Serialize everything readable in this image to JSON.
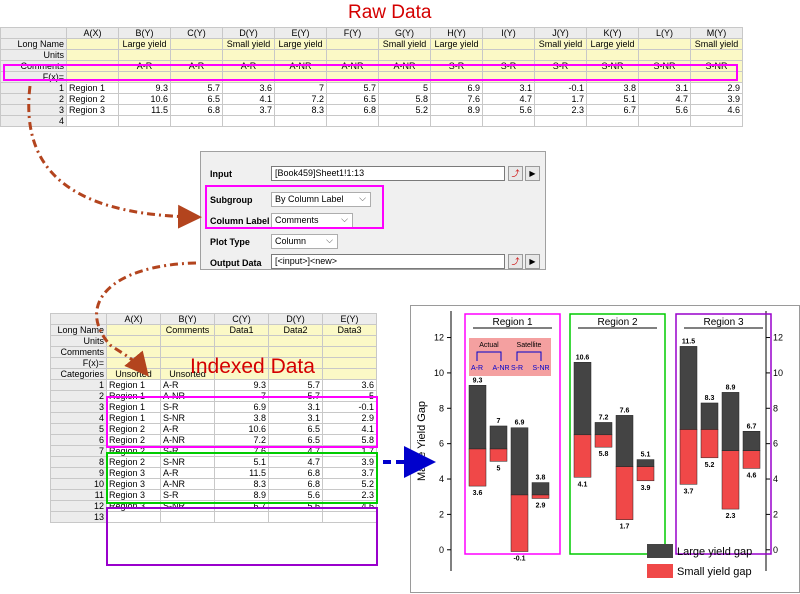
{
  "titles": {
    "raw": "Raw Data",
    "indexed": "Indexed Data"
  },
  "raw": {
    "columns": [
      "A(X)",
      "B(Y)",
      "C(Y)",
      "D(Y)",
      "E(Y)",
      "F(Y)",
      "G(Y)",
      "H(Y)",
      "I(Y)",
      "J(Y)",
      "K(Y)",
      "L(Y)",
      "M(Y)"
    ],
    "meta": [
      {
        "label": "Long Name",
        "cells": [
          "",
          "Large yield",
          "",
          "Small yield",
          "Large yield",
          "",
          "Small yield",
          "Large yield",
          "",
          "Small yield",
          "Large yield",
          "",
          "Small yield"
        ]
      },
      {
        "label": "Units",
        "cells": [
          "",
          "",
          "",
          "",
          "",
          "",
          "",
          "",
          "",
          "",
          "",
          "",
          ""
        ]
      },
      {
        "label": "Comments",
        "cells": [
          "",
          "A-R",
          "A-R",
          "A-R",
          "A-NR",
          "A-NR",
          "A-NR",
          "S-R",
          "S-R",
          "S-R",
          "S-NR",
          "S-NR",
          "S-NR"
        ]
      },
      {
        "label": "F(x)=",
        "cells": [
          "",
          "",
          "",
          "",
          "",
          "",
          "",
          "",
          "",
          "",
          "",
          "",
          ""
        ]
      }
    ],
    "rows": [
      {
        "n": "1",
        "cells": [
          "Region 1",
          "9.3",
          "5.7",
          "3.6",
          "7",
          "5.7",
          "5",
          "6.9",
          "3.1",
          "-0.1",
          "3.8",
          "3.1",
          "2.9"
        ]
      },
      {
        "n": "2",
        "cells": [
          "Region 2",
          "10.6",
          "6.5",
          "4.1",
          "7.2",
          "6.5",
          "5.8",
          "7.6",
          "4.7",
          "1.7",
          "5.1",
          "4.7",
          "3.9"
        ]
      },
      {
        "n": "3",
        "cells": [
          "Region 3",
          "11.5",
          "6.8",
          "3.7",
          "8.3",
          "6.8",
          "5.2",
          "8.9",
          "5.6",
          "2.3",
          "6.7",
          "5.6",
          "4.6"
        ]
      },
      {
        "n": "4",
        "cells": [
          "",
          "",
          "",
          "",
          "",
          "",
          "",
          "",
          "",
          "",
          "",
          "",
          ""
        ]
      }
    ]
  },
  "dialog": {
    "input_label": "Input",
    "input_value": "[Book459]Sheet1!1:13",
    "subgroup_label": "Subgroup",
    "subgroup_value": "By Column Label",
    "column_label_label": "Column Label",
    "column_label_value": "Comments",
    "plot_type_label": "Plot Type",
    "plot_type_value": "Column",
    "output_label": "Output Data",
    "output_value": "[<input>]<new>"
  },
  "indexed": {
    "columns": [
      "A(X)",
      "B(Y)",
      "C(Y)",
      "D(Y)",
      "E(Y)"
    ],
    "meta": [
      {
        "label": "Long Name",
        "cells": [
          "",
          "Comments",
          "Data1",
          "Data2",
          "Data3"
        ]
      },
      {
        "label": "Units",
        "cells": [
          "",
          "",
          "",
          "",
          ""
        ]
      },
      {
        "label": "Comments",
        "cells": [
          "",
          "",
          "",
          "",
          ""
        ]
      },
      {
        "label": "F(x)=",
        "cells": [
          "",
          "",
          "",
          "",
          ""
        ]
      },
      {
        "label": "Categories",
        "cells": [
          "Unsorted",
          "Unsorted",
          "",
          "",
          ""
        ]
      }
    ],
    "rows": [
      {
        "n": "1",
        "cells": [
          "Region 1",
          "A-R",
          "9.3",
          "5.7",
          "3.6"
        ]
      },
      {
        "n": "2",
        "cells": [
          "Region 1",
          "A-NR",
          "7",
          "5.7",
          "5"
        ]
      },
      {
        "n": "3",
        "cells": [
          "Region 1",
          "S-R",
          "6.9",
          "3.1",
          "-0.1"
        ]
      },
      {
        "n": "4",
        "cells": [
          "Region 1",
          "S-NR",
          "3.8",
          "3.1",
          "2.9"
        ]
      },
      {
        "n": "5",
        "cells": [
          "Region 2",
          "A-R",
          "10.6",
          "6.5",
          "4.1"
        ]
      },
      {
        "n": "6",
        "cells": [
          "Region 2",
          "A-NR",
          "7.2",
          "6.5",
          "5.8"
        ]
      },
      {
        "n": "7",
        "cells": [
          "Region 2",
          "S-R",
          "7.6",
          "4.7",
          "1.7"
        ]
      },
      {
        "n": "8",
        "cells": [
          "Region 2",
          "S-NR",
          "5.1",
          "4.7",
          "3.9"
        ]
      },
      {
        "n": "9",
        "cells": [
          "Region 3",
          "A-R",
          "11.5",
          "6.8",
          "3.7"
        ]
      },
      {
        "n": "10",
        "cells": [
          "Region 3",
          "A-NR",
          "8.3",
          "6.8",
          "5.2"
        ]
      },
      {
        "n": "11",
        "cells": [
          "Region 3",
          "S-R",
          "8.9",
          "5.6",
          "2.3"
        ]
      },
      {
        "n": "12",
        "cells": [
          "Region 3",
          "S-NR",
          "6.7",
          "5.6",
          "4.6"
        ]
      },
      {
        "n": "13",
        "cells": [
          "",
          "",
          "",
          "",
          ""
        ]
      }
    ]
  },
  "colors": {
    "accent_red": "#d40000",
    "magenta": "#ff00ff",
    "green": "#00cc00",
    "purple": "#9900cc",
    "blue": "#0000cc",
    "dark_bar": "#444444",
    "red_bar": "#f04848",
    "inset_bg": "#f4a0a0"
  },
  "chart_data": {
    "type": "bar",
    "ylabel": "Maize Yield Gap",
    "ylim": [
      -1.2,
      13.5
    ],
    "yticks": [
      0,
      2,
      4,
      6,
      8,
      10,
      12
    ],
    "panels": [
      "Region 1",
      "Region 2",
      "Region 3"
    ],
    "inset": {
      "title_a": "Actual",
      "title_b": "Satellite",
      "labels": [
        "A-R",
        "A-NR",
        "S-R",
        "S-NR"
      ]
    },
    "legend": [
      "Large yield gap",
      "Small yield gap"
    ],
    "groups": [
      {
        "region": "Region 1",
        "bars": [
          {
            "cat": "A-R",
            "large": 9.3,
            "small": 3.6
          },
          {
            "cat": "A-NR",
            "large": 7,
            "small": 5
          },
          {
            "cat": "S-R",
            "large": 6.9,
            "small": -0.1
          },
          {
            "cat": "S-NR",
            "large": 3.8,
            "small": 2.9
          }
        ]
      },
      {
        "region": "Region 2",
        "bars": [
          {
            "cat": "A-R",
            "large": 10.6,
            "small": 4.1
          },
          {
            "cat": "A-NR",
            "large": 7.2,
            "small": 5.8
          },
          {
            "cat": "S-R",
            "large": 7.6,
            "small": 1.7
          },
          {
            "cat": "S-NR",
            "large": 5.1,
            "small": 3.9
          }
        ]
      },
      {
        "region": "Region 3",
        "bars": [
          {
            "cat": "A-R",
            "large": 11.5,
            "small": 3.7
          },
          {
            "cat": "A-NR",
            "large": 8.3,
            "small": 5.2
          },
          {
            "cat": "S-R",
            "large": 8.9,
            "small": 2.3
          },
          {
            "cat": "S-NR",
            "large": 6.7,
            "small": 4.6
          }
        ]
      }
    ],
    "mids": [
      [
        5.7,
        5.7,
        3.1,
        3.1
      ],
      [
        6.5,
        6.5,
        4.7,
        4.7
      ],
      [
        6.8,
        6.8,
        5.6,
        5.6
      ]
    ]
  }
}
